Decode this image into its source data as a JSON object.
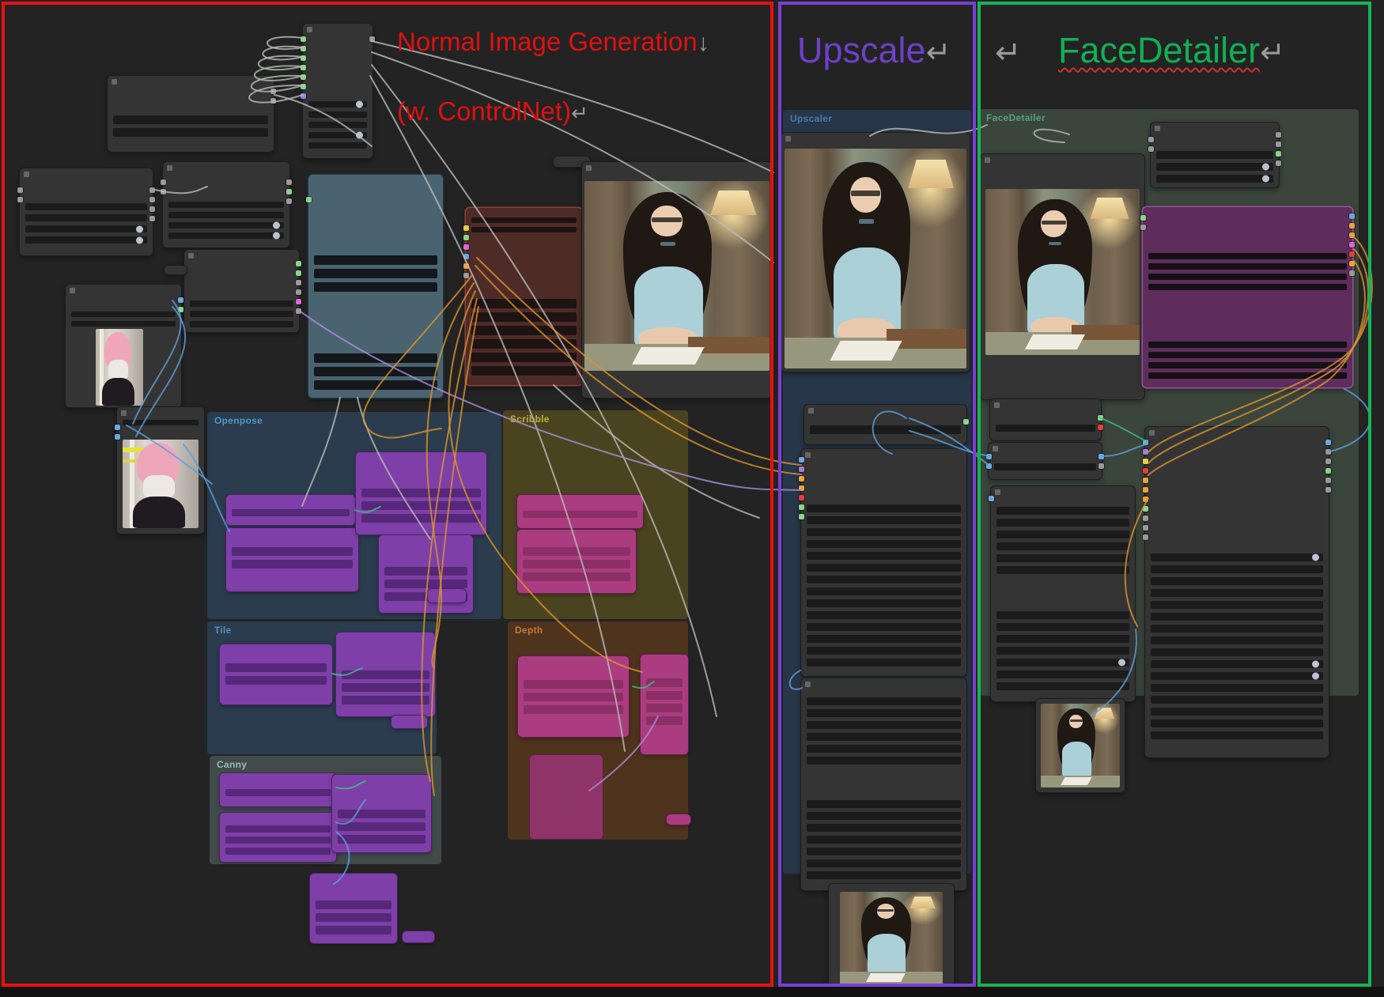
{
  "annotations": {
    "workflow_title_line1": "Normal Image Generation",
    "down_arrow": "↓",
    "workflow_title_line2": "(w. ControlNet)",
    "upscale_title": "Upscale",
    "facedetailer_title": "FaceDetailer",
    "return_arrow": "↵",
    "colors": {
      "title_red": "#e01010",
      "upscale_purple": "#6e40c8",
      "facedetailer_green": "#10b055",
      "arrow_gray": "#999999"
    }
  },
  "regions": {
    "normal_image_generation": {
      "border_color": "#e81010"
    },
    "upscale": {
      "border_color": "#7a3fd4"
    },
    "facedetailer": {
      "border_color": "#17b357"
    }
  },
  "groups": {
    "openpose": {
      "label": "Openpose",
      "label_color": "#4f9bd0"
    },
    "scribble": {
      "label": "Scribble",
      "label_color": "#c8b83e"
    },
    "tile": {
      "label": "Tile",
      "label_color": "#5f93c0"
    },
    "depth": {
      "label": "Depth",
      "label_color": "#cf7d3b"
    },
    "canny": {
      "label": "Canny",
      "label_color": "#9fc0ba"
    },
    "upscaler": {
      "label": "Upscaler",
      "label_color": "#4a7fb0"
    },
    "facedetailer": {
      "label": "FaceDetailer",
      "label_color": "#58a878"
    }
  },
  "images": {
    "generated_portrait": "generated photo: woman with glasses at desk with lamp",
    "reference_cosplay": "reference photo: pink-haired cosplayer"
  }
}
